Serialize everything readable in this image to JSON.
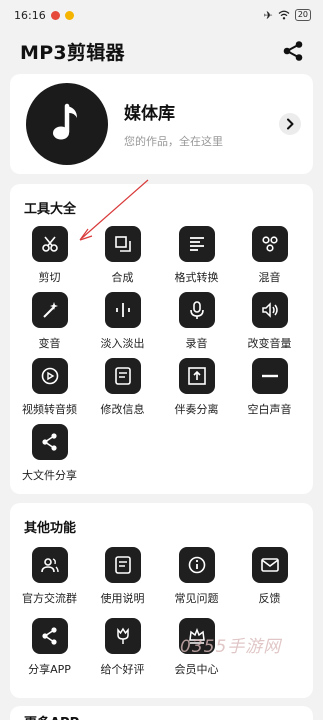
{
  "status_bar": {
    "time": "16:16",
    "battery": "20"
  },
  "header": {
    "title": "MP3剪辑器"
  },
  "library": {
    "title": "媒体库",
    "subtitle": "您的作品，全在这里"
  },
  "tools": {
    "section_title": "工具大全",
    "items": [
      {
        "label": "剪切",
        "icon": "scissors-icon"
      },
      {
        "label": "合成",
        "icon": "merge-icon"
      },
      {
        "label": "格式转换",
        "icon": "format-convert-icon"
      },
      {
        "label": "混音",
        "icon": "mix-icon"
      },
      {
        "label": "变音",
        "icon": "magic-wand-icon"
      },
      {
        "label": "淡入淡出",
        "icon": "fade-icon"
      },
      {
        "label": "录音",
        "icon": "microphone-icon"
      },
      {
        "label": "改变音量",
        "icon": "volume-icon"
      },
      {
        "label": "视频转音频",
        "icon": "video-to-audio-icon"
      },
      {
        "label": "修改信息",
        "icon": "edit-info-icon"
      },
      {
        "label": "伴奏分离",
        "icon": "separate-icon"
      },
      {
        "label": "空白声音",
        "icon": "silence-icon"
      },
      {
        "label": "大文件分享",
        "icon": "share-icon"
      }
    ]
  },
  "other": {
    "section_title": "其他功能",
    "items": [
      {
        "label": "官方交流群",
        "icon": "group-icon"
      },
      {
        "label": "使用说明",
        "icon": "manual-icon"
      },
      {
        "label": "常见问题",
        "icon": "info-icon"
      },
      {
        "label": "反馈",
        "icon": "mail-icon"
      },
      {
        "label": "分享APP",
        "icon": "share-icon"
      },
      {
        "label": "给个好评",
        "icon": "tulip-icon"
      },
      {
        "label": "会员中心",
        "icon": "crown-icon"
      }
    ]
  },
  "more": {
    "section_title": "更多APP"
  },
  "watermark": "0355手游网"
}
